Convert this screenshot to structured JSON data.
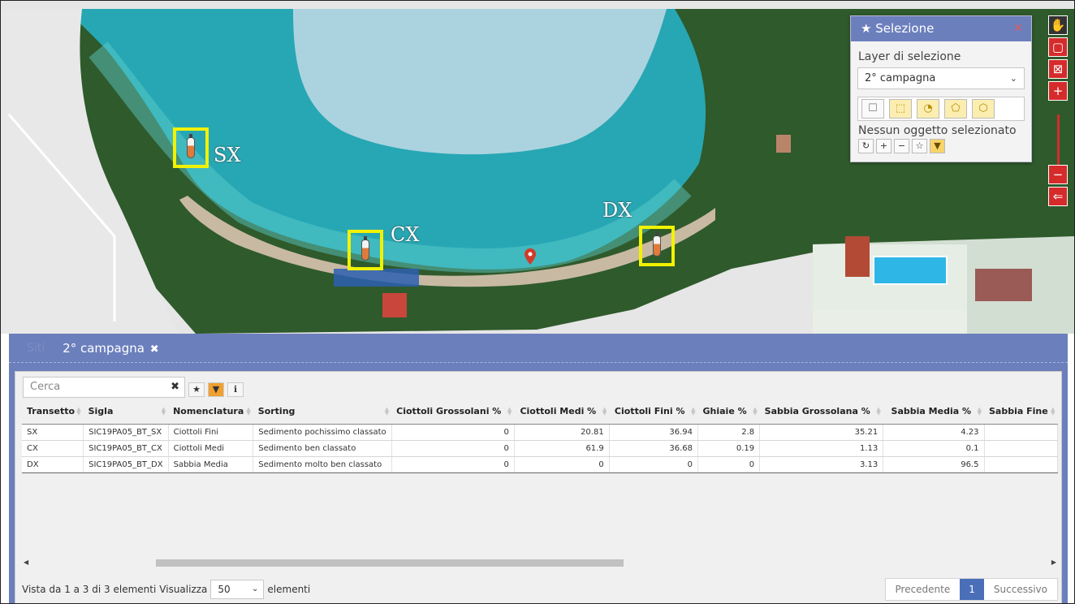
{
  "map": {
    "labels": {
      "sx": "SX",
      "cx": "CX",
      "dx": "DX"
    }
  },
  "map_tools": [
    {
      "icon": "hand-pan-icon",
      "glyph": "✋"
    },
    {
      "icon": "zoom-box-icon",
      "glyph": "▢"
    },
    {
      "icon": "zoom-extent-icon",
      "glyph": "⊠"
    },
    {
      "icon": "zoom-in-icon",
      "glyph": "+"
    },
    {
      "icon": "zoom-out-icon",
      "glyph": "−"
    },
    {
      "icon": "collapse-panel-icon",
      "glyph": "⇐"
    }
  ],
  "selection_panel": {
    "title": "Selezione",
    "close_glyph": "✕",
    "layer_label": "Layer di selezione",
    "layer_value": "2° campagna",
    "status": "Nessun oggetto selezionato"
  },
  "panel": {
    "tab_inactive": "Siti",
    "tab_active": "2° campagna",
    "tab_close": "✖"
  },
  "table": {
    "search_placeholder": "Cerca",
    "columns": [
      "Transetto",
      "Sigla",
      "Nomenclatura",
      "Sorting",
      "Ciottoli Grossolani %",
      "Ciottoli Medi %",
      "Ciottoli Fini %",
      "Ghiaie %",
      "Sabbia Grossolana %",
      "Sabbia Media %",
      "Sabbia Fine"
    ],
    "rows": [
      [
        "SX",
        "SIC19PA05_BT_SX",
        "Ciottoli Fini",
        "Sedimento pochissimo classato",
        "0",
        "20.81",
        "36.94",
        "2.8",
        "35.21",
        "4.23",
        ""
      ],
      [
        "CX",
        "SIC19PA05_BT_CX",
        "Ciottoli Medi",
        "Sedimento ben classato",
        "0",
        "61.9",
        "36.68",
        "0.19",
        "1.13",
        "0.1",
        ""
      ],
      [
        "DX",
        "SIC19PA05_BT_DX",
        "Sabbia Media",
        "Sedimento molto ben classato",
        "0",
        "0",
        "0",
        "0",
        "3.13",
        "96.5",
        ""
      ]
    ]
  },
  "footer": {
    "info": "Vista da 1 a 3 di 3 elementi",
    "show_label": "Visualizza",
    "page_size": "50",
    "elements_label": "elementi",
    "prev": "Precedente",
    "page": "1",
    "next": "Successivo"
  },
  "colors": {
    "panel_blue": "#6c7fbd",
    "tool_red": "#d52b2b",
    "highlight_yellow": "#f2f200",
    "filter_orange": "#f0a030"
  }
}
